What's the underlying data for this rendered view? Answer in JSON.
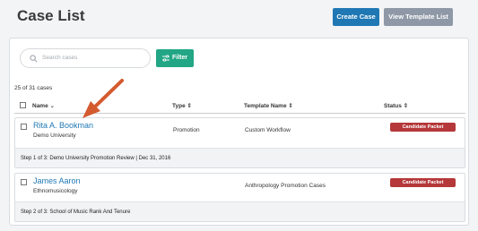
{
  "header": {
    "title": "Case List",
    "create_label": "Create Case",
    "template_label": "View Template List"
  },
  "toolbar": {
    "search_placeholder": "Search cases",
    "filter_label": "Filter"
  },
  "table": {
    "count_text": "25 of 31 cases",
    "columns": [
      "Name",
      "Type",
      "Template Name",
      "Status"
    ],
    "column_sort_markers": [
      "⌄",
      "⇕",
      "⇕",
      "⇕"
    ],
    "rows": [
      {
        "name": "Rita A. Bookman",
        "subtitle": "Demo University",
        "type": "Promotion",
        "template": "Custom Workflow",
        "status": "Candidate Packet",
        "step": "Step 1 of 3: Demo University Promotion Review  |  Dec 31, 2016"
      },
      {
        "name": "James Aaron",
        "subtitle": "Ethnomusicology",
        "type": "",
        "template": "Anthropology Promotion Cases",
        "status": "Candidate Packet",
        "step": "Step 2 of 3: School of Music Rank And Tenure"
      }
    ]
  },
  "colors": {
    "primary": "#1f78b4",
    "secondary": "#8e98a6",
    "filter": "#22a685",
    "status_badge": "#b5383a",
    "annotation_arrow": "#d45a2f"
  }
}
